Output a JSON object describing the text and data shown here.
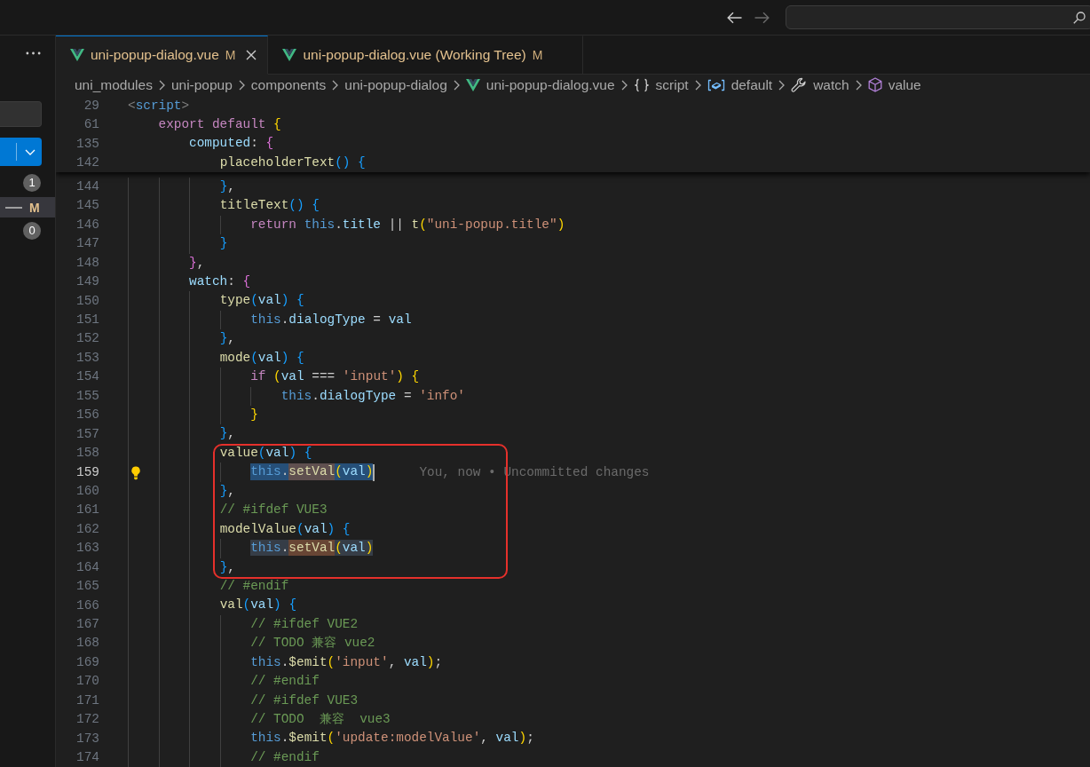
{
  "title_bar": {
    "nav_buttons": [
      {
        "kind": "back",
        "disabled": false
      },
      {
        "kind": "forward",
        "disabled": true
      }
    ]
  },
  "source_control": {
    "groups": [
      {
        "count": "1",
        "files": [
          {
            "status": "M",
            "selected": true
          }
        ]
      },
      {
        "count": "0"
      }
    ]
  },
  "tabs": [
    {
      "label": "uni-popup-dialog.vue",
      "status": "M",
      "selected": true
    },
    {
      "label": "uni-popup-dialog.vue (Working Tree)",
      "status": "M",
      "selected": false
    }
  ],
  "breadcrumb": [
    {
      "label": "uni_modules",
      "kind": "folder"
    },
    {
      "label": "uni-popup",
      "kind": "folder"
    },
    {
      "label": "components",
      "kind": "folder"
    },
    {
      "label": "uni-popup-dialog",
      "kind": "folder"
    },
    {
      "label": "uni-popup-dialog.vue",
      "kind": "file"
    },
    {
      "label": "script",
      "kind": "module"
    },
    {
      "label": "default",
      "kind": "variable"
    },
    {
      "label": "watch",
      "kind": "property"
    },
    {
      "label": "value",
      "kind": "method"
    }
  ],
  "code": {
    "lines": [
      {
        "kind": "sticky",
        "number": "29",
        "current": false,
        "lightbulb": false,
        "tokens": [
          {
            "text": "<",
            "kind": "punct"
          },
          {
            "text": "script",
            "kind": "tag"
          },
          {
            "text": ">",
            "kind": "punct"
          }
        ],
        "children": [
          {
            "kind": "sticky",
            "number": "61",
            "current": false,
            "lightbulb": false,
            "tokens": [
              {
                "text": "export default ",
                "kind": "kw"
              },
              {
                "text": "{",
                "kind": "b1"
              }
            ],
            "children": [
              {
                "kind": "sticky",
                "number": "135",
                "current": false,
                "lightbulb": false,
                "tokens": [
                  {
                    "text": "computed",
                    "kind": "prop"
                  },
                  {
                    "text": ": ",
                    "kind": "plain"
                  },
                  {
                    "text": "{",
                    "kind": "b2"
                  }
                ],
                "children": [
                  {
                    "kind": "sticky",
                    "number": "142",
                    "current": false,
                    "lightbulb": false,
                    "tokens": [
                      {
                        "text": "placeholderText",
                        "kind": "fn"
                      },
                      {
                        "text": "() {",
                        "kind": "b3"
                      }
                    ]
                  },
                  {
                    "kind": "line",
                    "number": "144",
                    "current": false,
                    "lightbulb": false,
                    "tokens": [
                      {
                        "text": "}",
                        "kind": "b3"
                      },
                      {
                        "text": ",",
                        "kind": "plain"
                      }
                    ]
                  },
                  {
                    "kind": "line",
                    "number": "145",
                    "current": false,
                    "lightbulb": false,
                    "tokens": [
                      {
                        "text": "titleText",
                        "kind": "fn"
                      },
                      {
                        "text": "() {",
                        "kind": "b3"
                      }
                    ],
                    "children": [
                      {
                        "kind": "line",
                        "number": "146",
                        "current": false,
                        "lightbulb": false,
                        "tokens": [
                          {
                            "text": "return ",
                            "kind": "kw"
                          },
                          {
                            "text": "this",
                            "kind": "this"
                          },
                          {
                            "text": ".",
                            "kind": "plain"
                          },
                          {
                            "text": "title",
                            "kind": "prop"
                          },
                          {
                            "text": " || ",
                            "kind": "plain"
                          },
                          {
                            "text": "t",
                            "kind": "fn"
                          },
                          {
                            "text": "(",
                            "kind": "b1"
                          },
                          {
                            "text": "\"uni-popup.title\"",
                            "kind": "str"
                          },
                          {
                            "text": ")",
                            "kind": "b1"
                          }
                        ]
                      }
                    ]
                  },
                  {
                    "kind": "line",
                    "number": "147",
                    "current": false,
                    "lightbulb": false,
                    "tokens": [
                      {
                        "text": "}",
                        "kind": "b3"
                      }
                    ]
                  }
                ]
              },
              {
                "kind": "line",
                "number": "148",
                "current": false,
                "lightbulb": false,
                "tokens": [
                  {
                    "text": "}",
                    "kind": "b2"
                  },
                  {
                    "text": ",",
                    "kind": "plain"
                  }
                ]
              },
              {
                "kind": "line",
                "number": "149",
                "current": false,
                "lightbulb": false,
                "tokens": [
                  {
                    "text": "watch",
                    "kind": "prop"
                  },
                  {
                    "text": ": ",
                    "kind": "plain"
                  },
                  {
                    "text": "{",
                    "kind": "b2"
                  }
                ],
                "children": [
                  {
                    "kind": "line",
                    "number": "150",
                    "current": false,
                    "lightbulb": false,
                    "tokens": [
                      {
                        "text": "type",
                        "kind": "fn"
                      },
                      {
                        "text": "(",
                        "kind": "b3"
                      },
                      {
                        "text": "val",
                        "kind": "param"
                      },
                      {
                        "text": ") {",
                        "kind": "b3"
                      }
                    ],
                    "children": [
                      {
                        "kind": "line",
                        "number": "151",
                        "current": false,
                        "lightbulb": false,
                        "tokens": [
                          {
                            "text": "this",
                            "kind": "this"
                          },
                          {
                            "text": ".",
                            "kind": "plain"
                          },
                          {
                            "text": "dialogType",
                            "kind": "prop"
                          },
                          {
                            "text": " = ",
                            "kind": "plain"
                          },
                          {
                            "text": "val",
                            "kind": "param"
                          }
                        ]
                      }
                    ]
                  },
                  {
                    "kind": "line",
                    "number": "152",
                    "current": false,
                    "lightbulb": false,
                    "tokens": [
                      {
                        "text": "}",
                        "kind": "b3"
                      },
                      {
                        "text": ",",
                        "kind": "plain"
                      }
                    ]
                  },
                  {
                    "kind": "line",
                    "number": "153",
                    "current": false,
                    "lightbulb": false,
                    "tokens": [
                      {
                        "text": "mode",
                        "kind": "fn"
                      },
                      {
                        "text": "(",
                        "kind": "b3"
                      },
                      {
                        "text": "val",
                        "kind": "param"
                      },
                      {
                        "text": ") {",
                        "kind": "b3"
                      }
                    ],
                    "children": [
                      {
                        "kind": "line",
                        "number": "154",
                        "current": false,
                        "lightbulb": false,
                        "tokens": [
                          {
                            "text": "if ",
                            "kind": "kw"
                          },
                          {
                            "text": "(",
                            "kind": "b1"
                          },
                          {
                            "text": "val",
                            "kind": "param"
                          },
                          {
                            "text": " === ",
                            "kind": "plain"
                          },
                          {
                            "text": "'input'",
                            "kind": "str"
                          },
                          {
                            "text": ") {",
                            "kind": "b1"
                          }
                        ],
                        "children": [
                          {
                            "kind": "line",
                            "number": "155",
                            "current": false,
                            "lightbulb": false,
                            "tokens": [
                              {
                                "text": "this",
                                "kind": "this"
                              },
                              {
                                "text": ".",
                                "kind": "plain"
                              },
                              {
                                "text": "dialogType",
                                "kind": "prop"
                              },
                              {
                                "text": " = ",
                                "kind": "plain"
                              },
                              {
                                "text": "'info'",
                                "kind": "str"
                              }
                            ]
                          }
                        ]
                      },
                      {
                        "kind": "line",
                        "number": "156",
                        "current": false,
                        "lightbulb": false,
                        "tokens": [
                          {
                            "text": "}",
                            "kind": "b1"
                          }
                        ]
                      }
                    ]
                  },
                  {
                    "kind": "line",
                    "number": "157",
                    "current": false,
                    "lightbulb": false,
                    "tokens": [
                      {
                        "text": "}",
                        "kind": "b3"
                      },
                      {
                        "text": ",",
                        "kind": "plain"
                      }
                    ]
                  },
                  {
                    "kind": "frame",
                    "children": [
                      {
                        "kind": "line",
                        "number": "158",
                        "current": false,
                        "lightbulb": false,
                        "tokens": [
                          {
                            "text": "value",
                            "kind": "fn"
                          },
                          {
                            "text": "(",
                            "kind": "b3"
                          },
                          {
                            "text": "val",
                            "kind": "param"
                          },
                          {
                            "text": ") {",
                            "kind": "b3"
                          }
                        ],
                        "children": [
                          {
                            "kind": "line",
                            "number": "159",
                            "current": true,
                            "lightbulb": true,
                            "blame": "You, now • Uncommitted changes",
                            "tokens": [
                              {
                                "kind": "selection",
                                "tokens": [
                                  {
                                    "text": "this",
                                    "kind": "this"
                                  },
                                  {
                                    "text": ".",
                                    "kind": "plain"
                                  },
                                  {
                                    "kind": "word-highlight",
                                    "tokens": [
                                      {
                                        "text": "setVal",
                                        "kind": "fn"
                                      }
                                    ]
                                  },
                                  {
                                    "text": "(",
                                    "kind": "b1"
                                  },
                                  {
                                    "text": "val",
                                    "kind": "param"
                                  },
                                  {
                                    "text": ")",
                                    "kind": "b1"
                                  }
                                ]
                              }
                            ]
                          }
                        ]
                      },
                      {
                        "kind": "line",
                        "number": "160",
                        "current": false,
                        "lightbulb": false,
                        "tokens": [
                          {
                            "text": "}",
                            "kind": "b3"
                          },
                          {
                            "text": ",",
                            "kind": "plain"
                          }
                        ]
                      },
                      {
                        "kind": "line",
                        "number": "161",
                        "current": false,
                        "lightbulb": false,
                        "tokens": [
                          {
                            "text": "// #ifdef VUE3",
                            "kind": "cmt"
                          }
                        ]
                      },
                      {
                        "kind": "line",
                        "number": "162",
                        "current": false,
                        "lightbulb": false,
                        "tokens": [
                          {
                            "text": "modelValue",
                            "kind": "fn"
                          },
                          {
                            "text": "(",
                            "kind": "b3"
                          },
                          {
                            "text": "val",
                            "kind": "param"
                          },
                          {
                            "text": ") {",
                            "kind": "b3"
                          }
                        ],
                        "children": [
                          {
                            "kind": "line",
                            "number": "163",
                            "current": false,
                            "lightbulb": false,
                            "tokens": [
                              {
                                "kind": "match",
                                "tokens": [
                                  {
                                    "text": "this",
                                    "kind": "this"
                                  },
                                  {
                                    "text": ".",
                                    "kind": "plain"
                                  },
                                  {
                                    "kind": "word-highlight",
                                    "tokens": [
                                      {
                                        "text": "setVal",
                                        "kind": "fn"
                                      }
                                    ]
                                  },
                                  {
                                    "text": "(",
                                    "kind": "b1"
                                  },
                                  {
                                    "text": "val",
                                    "kind": "param"
                                  },
                                  {
                                    "text": ")",
                                    "kind": "b1"
                                  }
                                ]
                              }
                            ]
                          }
                        ]
                      },
                      {
                        "kind": "line",
                        "number": "164",
                        "current": false,
                        "lightbulb": false,
                        "tokens": [
                          {
                            "text": "}",
                            "kind": "b3"
                          },
                          {
                            "text": ",",
                            "kind": "plain"
                          }
                        ]
                      }
                    ]
                  },
                  {
                    "kind": "line",
                    "number": "165",
                    "current": false,
                    "lightbulb": false,
                    "tokens": [
                      {
                        "text": "// #endif",
                        "kind": "cmt"
                      }
                    ]
                  },
                  {
                    "kind": "line",
                    "number": "166",
                    "current": false,
                    "lightbulb": false,
                    "tokens": [
                      {
                        "text": "val",
                        "kind": "fn"
                      },
                      {
                        "text": "(",
                        "kind": "b3"
                      },
                      {
                        "text": "val",
                        "kind": "param"
                      },
                      {
                        "text": ") {",
                        "kind": "b3"
                      }
                    ],
                    "children": [
                      {
                        "kind": "line",
                        "number": "167",
                        "current": false,
                        "lightbulb": false,
                        "tokens": [
                          {
                            "text": "// #ifdef VUE2",
                            "kind": "cmt"
                          }
                        ]
                      },
                      {
                        "kind": "line",
                        "number": "168",
                        "current": false,
                        "lightbulb": false,
                        "tokens": [
                          {
                            "text": "// TODO 兼容 vue2",
                            "kind": "cmt"
                          }
                        ]
                      },
                      {
                        "kind": "line",
                        "number": "169",
                        "current": false,
                        "lightbulb": false,
                        "tokens": [
                          {
                            "text": "this",
                            "kind": "this"
                          },
                          {
                            "text": ".",
                            "kind": "plain"
                          },
                          {
                            "text": "$emit",
                            "kind": "fn"
                          },
                          {
                            "text": "(",
                            "kind": "b1"
                          },
                          {
                            "text": "'input'",
                            "kind": "str"
                          },
                          {
                            "text": ", ",
                            "kind": "plain"
                          },
                          {
                            "text": "val",
                            "kind": "param"
                          },
                          {
                            "text": ")",
                            "kind": "b1"
                          },
                          {
                            "text": ";",
                            "kind": "plain"
                          }
                        ]
                      },
                      {
                        "kind": "line",
                        "number": "170",
                        "current": false,
                        "lightbulb": false,
                        "tokens": [
                          {
                            "text": "// #endif",
                            "kind": "cmt"
                          }
                        ]
                      },
                      {
                        "kind": "line",
                        "number": "171",
                        "current": false,
                        "lightbulb": false,
                        "tokens": [
                          {
                            "text": "// #ifdef VUE3",
                            "kind": "cmt"
                          }
                        ]
                      },
                      {
                        "kind": "line",
                        "number": "172",
                        "current": false,
                        "lightbulb": false,
                        "tokens": [
                          {
                            "text": "// TODO  兼容  vue3",
                            "kind": "cmt"
                          }
                        ]
                      },
                      {
                        "kind": "line",
                        "number": "173",
                        "current": false,
                        "lightbulb": false,
                        "tokens": [
                          {
                            "text": "this",
                            "kind": "this"
                          },
                          {
                            "text": ".",
                            "kind": "plain"
                          },
                          {
                            "text": "$emit",
                            "kind": "fn"
                          },
                          {
                            "text": "(",
                            "kind": "b1"
                          },
                          {
                            "text": "'update:modelValue'",
                            "kind": "str"
                          },
                          {
                            "text": ", ",
                            "kind": "plain"
                          },
                          {
                            "text": "val",
                            "kind": "param"
                          },
                          {
                            "text": ")",
                            "kind": "b1"
                          },
                          {
                            "text": ";",
                            "kind": "plain"
                          }
                        ]
                      },
                      {
                        "kind": "line",
                        "number": "174",
                        "current": false,
                        "lightbulb": false,
                        "tokens": [
                          {
                            "text": "// #endif",
                            "kind": "cmt"
                          }
                        ]
                      }
                    ]
                  }
                ]
              }
            ]
          }
        ]
      }
    ]
  }
}
